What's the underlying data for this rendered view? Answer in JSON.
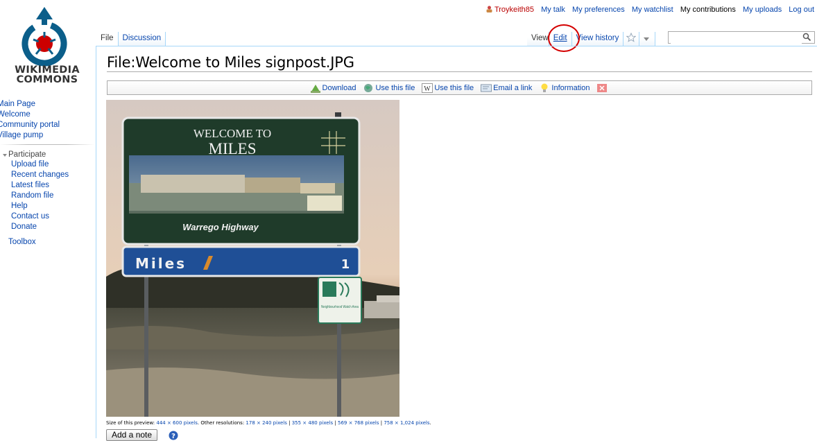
{
  "personal": {
    "username": "Troykeith85",
    "links": [
      "My talk",
      "My preferences",
      "My watchlist",
      "My contributions",
      "My uploads",
      "Log out"
    ]
  },
  "logo": {
    "line1": "WIKIMEDIA",
    "line2": "COMMONS"
  },
  "sidebar": {
    "main": [
      "Main Page",
      "Welcome",
      "Community portal",
      "Village pump"
    ],
    "participate_heading": "Participate",
    "participate": [
      "Upload file",
      "Recent changes",
      "Latest files",
      "Random file",
      "Help",
      "Contact us",
      "Donate"
    ],
    "toolbox": "Toolbox"
  },
  "tabs": {
    "left": [
      "File",
      "Discussion"
    ],
    "view": "View",
    "edit": "Edit",
    "history": "View history"
  },
  "search": {
    "placeholder": ""
  },
  "page": {
    "title": "File:Welcome to Miles signpost.JPG"
  },
  "toolbar": {
    "download": "Download",
    "use_commons": "Use this file",
    "use_wiki": "Use this file",
    "email": "Email a link",
    "information": "Information"
  },
  "photo": {
    "sign_line1": "WELCOME TO",
    "sign_line2": "MILES",
    "highway": "Warrego Highway",
    "town": "Miles",
    "distance": "1",
    "small_sign": "Neighbourhood Watch Area"
  },
  "caption": {
    "prefix": "Size of this preview:",
    "preview": "444 × 600 pixels",
    "other": "Other resolutions:",
    "r1": "178 × 240 pixels",
    "r2": "355 × 480 pixels",
    "r3": "569 × 768 pixels",
    "r4": "758 × 1,024 pixels"
  },
  "buttons": {
    "add_note": "Add a note"
  },
  "colors": {
    "link": "#0645ad",
    "annotation_circle": "#d40000",
    "border": "#a7d7f9"
  }
}
